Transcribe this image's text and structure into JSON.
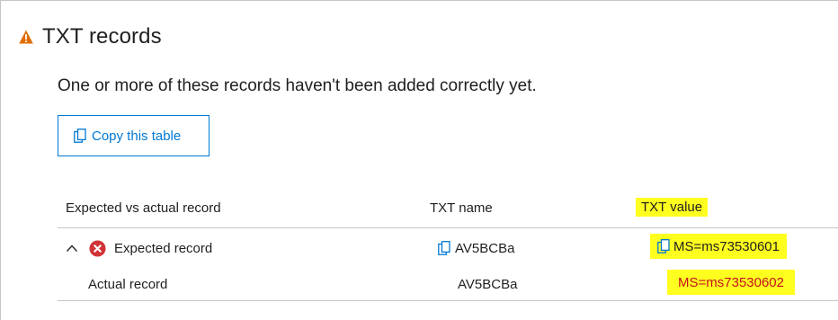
{
  "section": {
    "title": "TXT records",
    "warning_icon": "warning-triangle-icon",
    "subtitle": "One or more of these records haven't been added correctly yet.",
    "copy_button_label": "Copy this table"
  },
  "table": {
    "headers": [
      "Expected vs actual record",
      "TXT name",
      "TXT value"
    ],
    "rows": [
      {
        "record": "Expected record",
        "name": "AV5BCBa",
        "value": "MS=ms73530601"
      },
      {
        "record": "Actual record",
        "name": "AV5BCBa",
        "value": "MS=ms73530602"
      }
    ]
  },
  "colors": {
    "accent": "#0078d4",
    "warning": "#e06e00",
    "error": "#d13438",
    "highlight": "#ffff1f",
    "mismatch_text": "#c50f1f"
  }
}
